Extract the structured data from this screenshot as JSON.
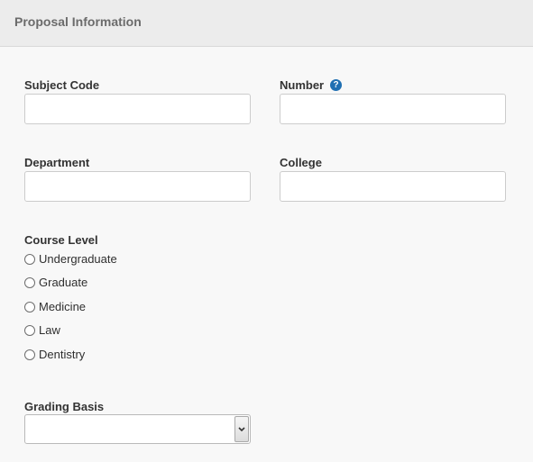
{
  "panel": {
    "title": "Proposal Information"
  },
  "fields": {
    "subject_code": {
      "label": "Subject Code",
      "value": "",
      "placeholder": ""
    },
    "number": {
      "label": "Number",
      "value": "",
      "placeholder": "",
      "help_icon": "question-circle-icon"
    },
    "department": {
      "label": "Department",
      "value": "",
      "placeholder": ""
    },
    "college": {
      "label": "College",
      "value": "",
      "placeholder": ""
    }
  },
  "course_level": {
    "label": "Course Level",
    "options": [
      {
        "label": "Undergraduate",
        "selected": false
      },
      {
        "label": "Graduate",
        "selected": false
      },
      {
        "label": "Medicine",
        "selected": false
      },
      {
        "label": "Law",
        "selected": false
      },
      {
        "label": "Dentistry",
        "selected": false
      }
    ]
  },
  "grading_basis": {
    "label": "Grading Basis",
    "selected_value": ""
  },
  "colors": {
    "header_background": "#ececec",
    "page_background": "#f8f8f8",
    "help_icon": "#1f6fb2"
  }
}
